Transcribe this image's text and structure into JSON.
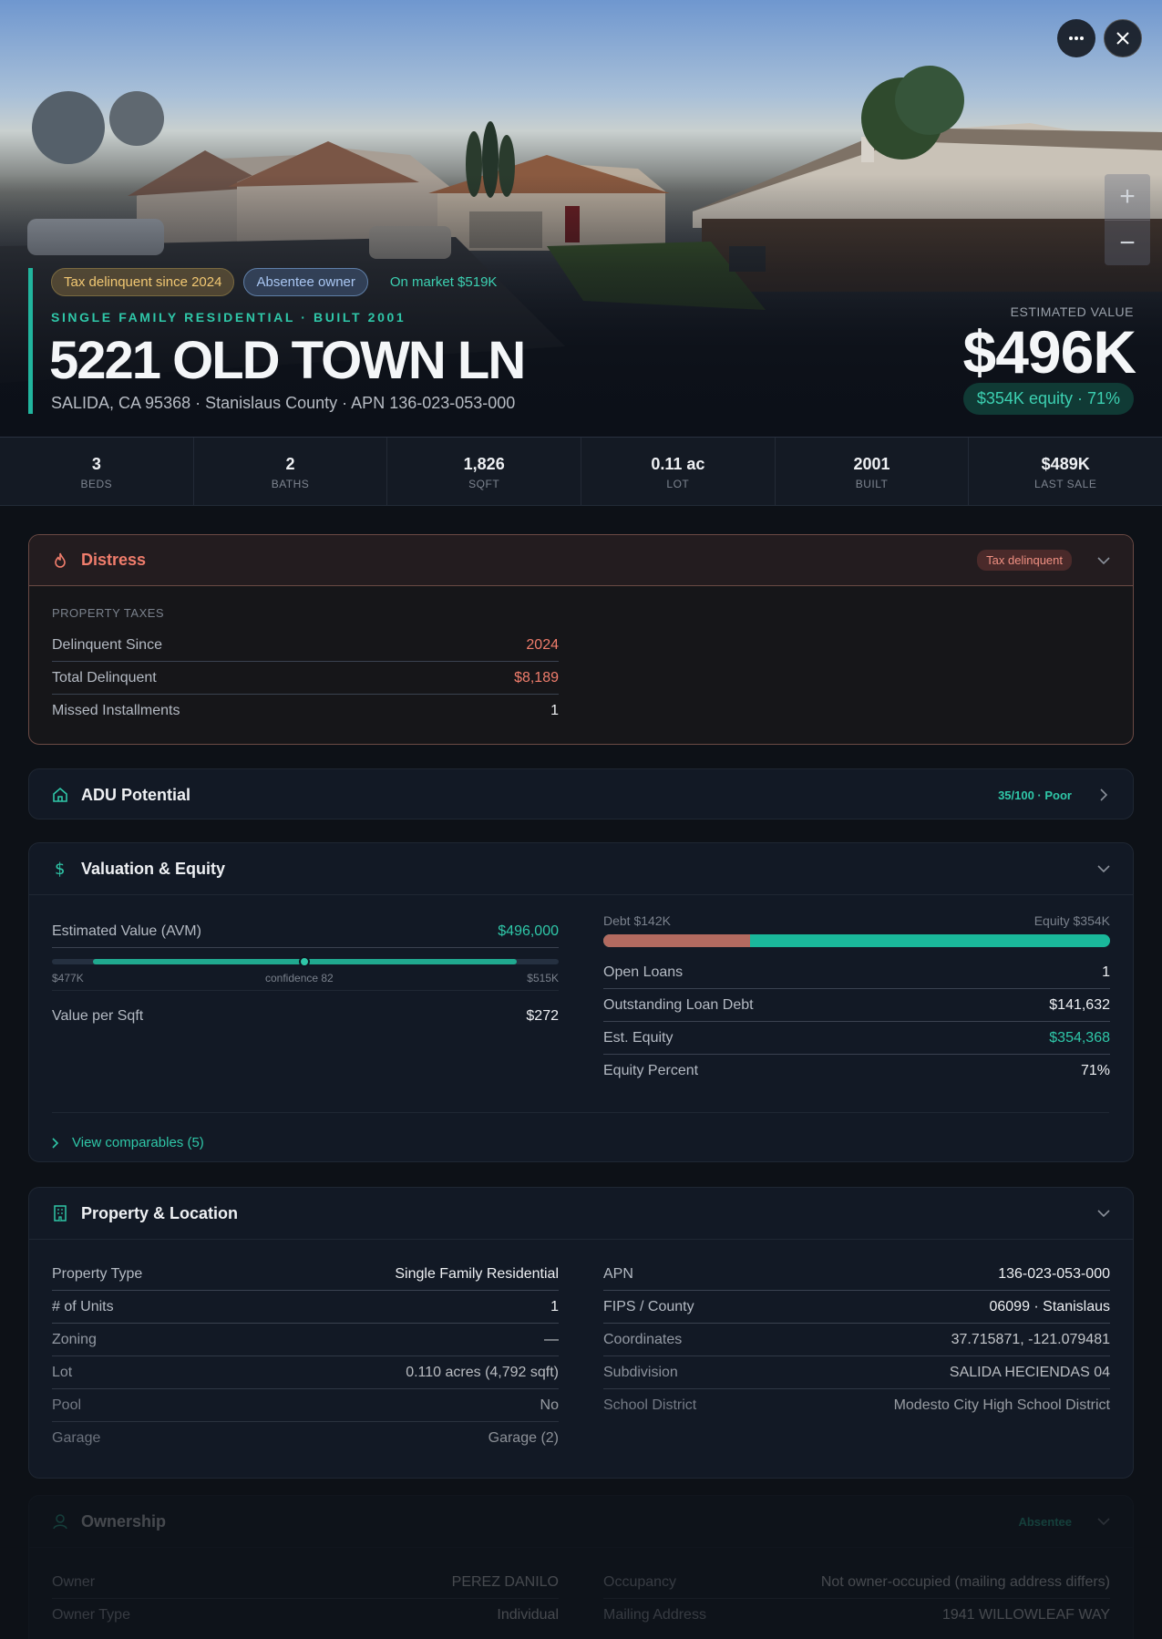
{
  "hero": {
    "tags": {
      "tax": "Tax delinquent since 2024",
      "absentee": "Absentee owner",
      "market": "On market $519K"
    },
    "property_type_line": "SINGLE FAMILY RESIDENTIAL · BUILT 2001",
    "address": "5221 OLD TOWN LN",
    "sub_address": "SALIDA, CA 95368 · Stanislaus County · APN 136-023-053-000",
    "est_label": "ESTIMATED VALUE",
    "est_value": "$496K",
    "equity_pill": "$354K equity · 71%",
    "zoom_in": "+",
    "zoom_out": "−"
  },
  "stats": [
    {
      "value": "3",
      "label": "BEDS"
    },
    {
      "value": "2",
      "label": "BATHS"
    },
    {
      "value": "1,826",
      "label": "SQFT"
    },
    {
      "value": "0.11 ac",
      "label": "LOT"
    },
    {
      "value": "2001",
      "label": "BUILT"
    },
    {
      "value": "$489K",
      "label": "LAST SALE"
    }
  ],
  "distress": {
    "title": "Distress",
    "badge": "Tax delinquent",
    "section_label": "PROPERTY TAXES",
    "rows": [
      {
        "k": "Delinquent Since",
        "v": "2024"
      },
      {
        "k": "Total Delinquent",
        "v": "$8,189"
      },
      {
        "k": "Missed Installments",
        "v": "1"
      }
    ]
  },
  "adu": {
    "title": "ADU Potential",
    "score": "35/100 · Poor"
  },
  "valuation": {
    "title": "Valuation & Equity",
    "avm_label": "Estimated Value (AVM)",
    "avm_value": "$496,000",
    "range_low": "$477K",
    "range_mid": "confidence 82",
    "range_high": "$515K",
    "confidence": 82,
    "vps_label": "Value per Sqft",
    "vps_value": "$272",
    "debt_label": "Debt $142K",
    "equity_label": "Equity $354K",
    "debt_fraction": 0.29,
    "rows": [
      {
        "k": "Open Loans",
        "v": "1"
      },
      {
        "k": "Outstanding Loan Debt",
        "v": "$141,632"
      },
      {
        "k": "Est. Equity",
        "v": "$354,368"
      },
      {
        "k": "Equity Percent",
        "v": "71%"
      }
    ],
    "comps": "View comparables (5)"
  },
  "property": {
    "title": "Property & Location",
    "left": [
      {
        "k": "Property Type",
        "v": "Single Family Residential"
      },
      {
        "k": "# of Units",
        "v": "1"
      },
      {
        "k": "Zoning",
        "v": "—"
      },
      {
        "k": "Lot",
        "v": "0.110 acres (4,792 sqft)"
      },
      {
        "k": "Pool",
        "v": "No"
      },
      {
        "k": "Garage",
        "v": "Garage (2)"
      }
    ],
    "right": [
      {
        "k": "APN",
        "v": "136-023-053-000"
      },
      {
        "k": "FIPS / County",
        "v": "06099 · Stanislaus"
      },
      {
        "k": "Coordinates",
        "v": "37.715871, -121.079481"
      },
      {
        "k": "Subdivision",
        "v": "SALIDA HECIENDAS 04"
      },
      {
        "k": "School District",
        "v": "Modesto City High School District"
      }
    ]
  },
  "ownership": {
    "title": "Ownership",
    "badge": "Absentee",
    "left": [
      {
        "k": "Owner",
        "v": "PEREZ DANILO"
      },
      {
        "k": "Owner Type",
        "v": "Individual"
      }
    ],
    "right": [
      {
        "k": "Occupancy",
        "v": "Not owner-occupied (mailing address differs)"
      },
      {
        "k": "Mailing Address",
        "v": "1941 WILLOWLEAF WAY"
      }
    ]
  },
  "colors": {
    "accent": "#2fc7a8",
    "distress": "#f07d6c",
    "debt": "#b26a60"
  }
}
